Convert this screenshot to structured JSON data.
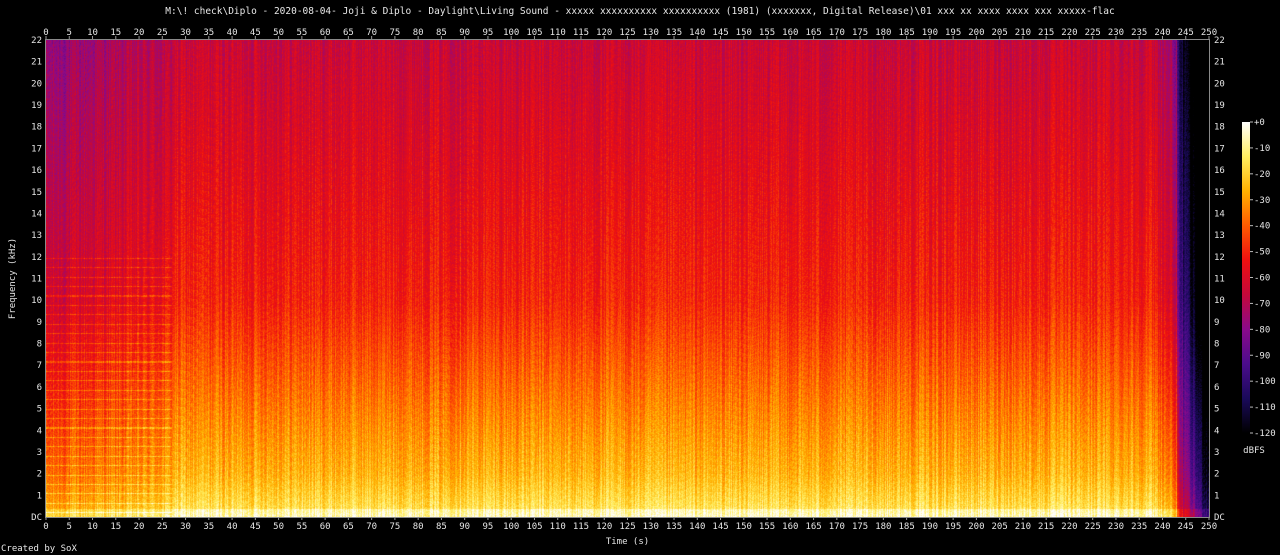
{
  "title": "M:\\! check\\Diplo - 2020-08-04- Joji & Diplo - Daylight\\Living Sound - xxxxx xxxxxxxxxx xxxxxxxxxx (1981) (xxxxxxx, Digital Release)\\01 xxx xx xxxx xxxx xxx xxxxx-flac",
  "footer": "Created by SoX",
  "chart_data": {
    "type": "heatmap",
    "title": "M:\\! check\\Diplo - 2020-08-04- Joji & Diplo - Daylight\\Living Sound - xxxxx xxxxxxxxxx xxxxxxxxxx (1981) (xxxxxxx, Digital Release)\\01 xxx xx xxxx xxxx xxx xxxxx-flac",
    "xlabel": "Time (s)",
    "ylabel": "Frequency (kHz)",
    "xlim": [
      0,
      250
    ],
    "ylim": [
      0,
      22
    ],
    "x_ticks": [
      "0",
      "5",
      "10",
      "15",
      "20",
      "25",
      "30",
      "35",
      "40",
      "45",
      "50",
      "55",
      "60",
      "65",
      "70",
      "75",
      "80",
      "85",
      "90",
      "95",
      "100",
      "105",
      "110",
      "115",
      "120",
      "125",
      "130",
      "135",
      "140",
      "145",
      "150",
      "155",
      "160",
      "165",
      "170",
      "175",
      "180",
      "185",
      "190",
      "195",
      "200",
      "205",
      "210",
      "215",
      "220",
      "225",
      "230",
      "235",
      "240",
      "245",
      "250"
    ],
    "y_ticks": [
      "DC",
      "1",
      "2",
      "3",
      "4",
      "5",
      "6",
      "7",
      "8",
      "9",
      "10",
      "11",
      "12",
      "13",
      "14",
      "15",
      "16",
      "17",
      "18",
      "19",
      "20",
      "21",
      "22"
    ],
    "colorbar": {
      "label": "dBFS",
      "ticks": [
        "+0",
        "-10",
        "-20",
        "-30",
        "-40",
        "-50",
        "-60",
        "-70",
        "-80",
        "-90",
        "-100",
        "-110",
        "-120"
      ],
      "range_db": [
        -120,
        0
      ],
      "colors": [
        "#000000",
        "#1a0a5a",
        "#4b0c8c",
        "#8a0a8a",
        "#c4083a",
        "#ee1010",
        "#ff5a00",
        "#ffb000",
        "#ffee60",
        "#ffffff"
      ]
    },
    "audio_end_s": 243,
    "description_levels": {
      "low_band_0_2kHz_db": -25,
      "mid_band_2_10kHz_db": -50,
      "high_band_10_22kHz_db": -65
    }
  }
}
